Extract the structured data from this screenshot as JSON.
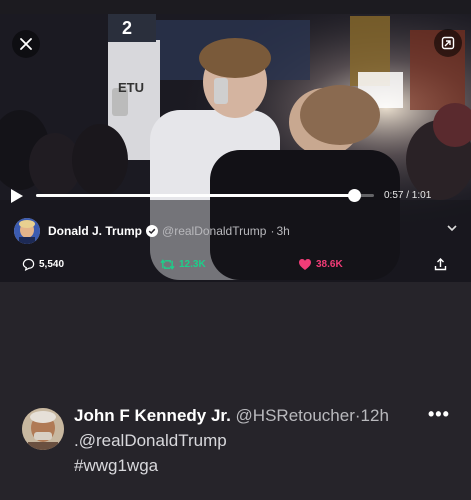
{
  "video": {
    "overlay_sign": "2",
    "sign_letters": "ETU",
    "progress": 0.9423,
    "time_label": "0:57 / 1:01"
  },
  "author": {
    "name": "Donald J. Trump",
    "handle": "@realDonaldTrump",
    "sep": "·",
    "age": "3h"
  },
  "actions": {
    "replies": "5,540",
    "retweets": "12.3K",
    "likes": "38.6K"
  },
  "tweet": {
    "name": "John F Kennedy Jr.",
    "handle": "@HSRetoucher",
    "sep": "·",
    "age": "12h",
    "text_line1": ".@realDonaldTrump",
    "text_line2": "#wwg1wga",
    "more_label": "•••"
  },
  "colors": {
    "background": "#26242a",
    "retweet_green": "#1dcf8a",
    "like_pink": "#f23c77",
    "verified_white": "#ffffff"
  },
  "icons": [
    "close-icon",
    "expand-icon",
    "play-icon",
    "verified-icon",
    "chevron-down-icon",
    "reply-icon",
    "retweet-icon",
    "like-icon",
    "share-icon",
    "more-icon"
  ]
}
